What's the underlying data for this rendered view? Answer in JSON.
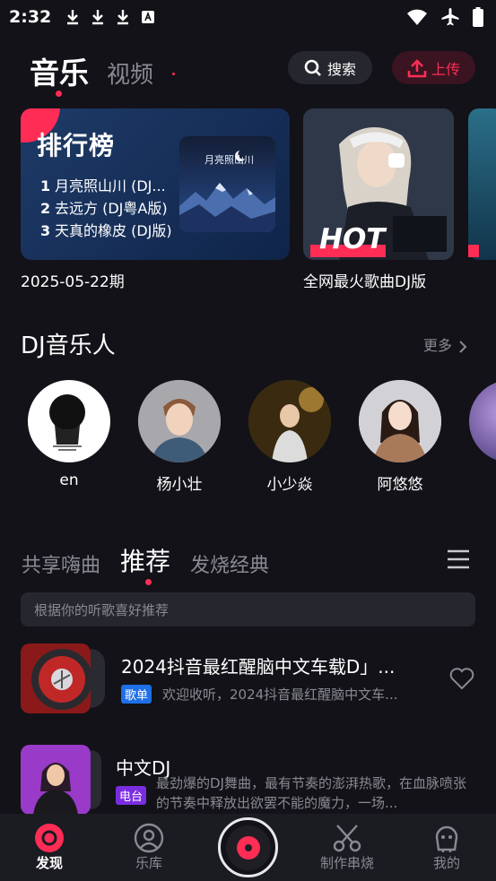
{
  "status_bar": {
    "time": "2:32"
  },
  "header": {
    "tabs": [
      {
        "label": "音乐"
      },
      {
        "label": "视频"
      }
    ],
    "search_label": "搜索",
    "upload_label": "上传"
  },
  "rank_card": {
    "title": "排行榜",
    "items": [
      {
        "num": "1",
        "text": "月亮照山川 (DJ..."
      },
      {
        "num": "2",
        "text": "去远方 (DJ粤A版)"
      },
      {
        "num": "3",
        "text": "天真的橡皮 (DJ版)"
      }
    ],
    "cover_text": "月亮照山川",
    "date": "2025-05-22期"
  },
  "hot_card": {
    "badge": "HOT",
    "caption": "全网最火歌曲DJ版"
  },
  "dj_section": {
    "title": "DJ音乐人",
    "more_label": "更多",
    "artists": [
      {
        "name": "en"
      },
      {
        "name": "杨小壮"
      },
      {
        "name": "小少焱"
      },
      {
        "name": "阿悠悠"
      }
    ]
  },
  "feed_tabs": [
    {
      "label": "共享嗨曲"
    },
    {
      "label": "推荐"
    },
    {
      "label": "发烧经典"
    }
  ],
  "hint": "根据你的听歌喜好推荐",
  "feed": [
    {
      "title": "2024抖音最红醒脑中文车载D」...",
      "badge": "歌单",
      "badge_color": "#1e6fe8",
      "desc": "欢迎收听，2024抖音最红醒脑中文车..."
    },
    {
      "title": "中文DJ",
      "badge": "电台",
      "badge_color": "#7a2de0",
      "desc": "最劲爆的DJ舞曲，最有节奏的澎湃热歌，在血脉喷张的节奏中释放出欲罢不能的魔力，一场..."
    }
  ],
  "bottom_nav": [
    {
      "label": "发现",
      "icon": "disc-icon"
    },
    {
      "label": "乐库",
      "icon": "person-circle-icon"
    },
    {
      "label": "制作串烧",
      "icon": "scissors-icon"
    },
    {
      "label": "我的",
      "icon": "ghost-icon"
    }
  ],
  "colors": {
    "accent": "#ff2d55",
    "background": "#121218",
    "muted": "#8a8a92"
  }
}
